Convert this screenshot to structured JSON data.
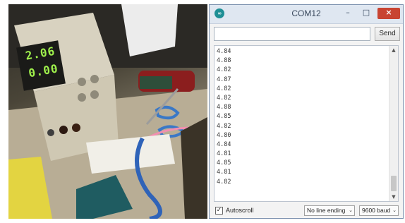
{
  "window": {
    "title": "COM12",
    "app_icon_text": "∞",
    "minimize_glyph": "–",
    "maximize_glyph": "□",
    "close_glyph": "×"
  },
  "send_row": {
    "input_value": "",
    "send_label": "Send"
  },
  "serial_output": {
    "lines": [
      "4.84",
      "4.88",
      "4.82",
      "4.87",
      "4.82",
      "4.82",
      "4.88",
      "4.85",
      "4.82",
      "4.80",
      "4.84",
      "4.81",
      "4.85",
      "4.81",
      "4.82"
    ]
  },
  "bottom_bar": {
    "autoscroll_label": "Autoscroll",
    "autoscroll_checked": true,
    "checkmark": "✓",
    "line_ending_value": "No line ending",
    "baud_value": "9600 baud"
  },
  "photo": {
    "supply_display_top": "2.06",
    "supply_display_bottom": "0.00"
  }
}
